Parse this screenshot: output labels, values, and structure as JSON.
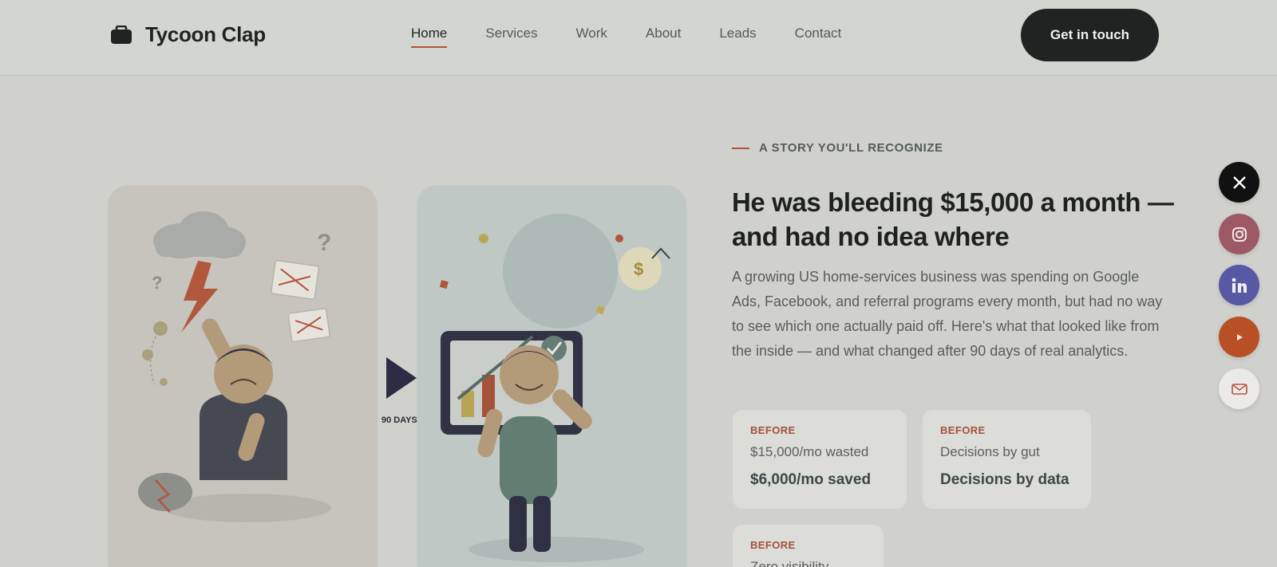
{
  "brand": {
    "name": "Tycoon Clap",
    "icon": "briefcase-icon"
  },
  "nav": {
    "items": [
      {
        "label": "Home",
        "active": true
      },
      {
        "label": "Services",
        "active": false
      },
      {
        "label": "Work",
        "active": false
      },
      {
        "label": "About",
        "active": false
      },
      {
        "label": "Leads",
        "active": false
      },
      {
        "label": "Contact",
        "active": false
      }
    ],
    "cta_label": "Get in touch"
  },
  "illustration": {
    "transition_label": "90 DAYS",
    "before_symbols": [
      "?",
      "?"
    ],
    "after_symbol": "$"
  },
  "story": {
    "eyebrow": "A STORY YOU'LL RECOGNIZE",
    "headline": "He was bleeding $15,000 a month — and had no idea where",
    "body": "A growing US home-services business was spending on Google Ads, Facebook, and referral programs every month, but had no way to see which one actually paid off. Here's what that looked like from the inside — and what changed after 90 days of real analytics.",
    "cards": [
      {
        "tag": "BEFORE",
        "before": "$15,000/mo wasted",
        "after": "$6,000/mo saved"
      },
      {
        "tag": "BEFORE",
        "before": "Decisions by gut",
        "after": "Decisions by data"
      },
      {
        "tag": "BEFORE",
        "before": "Zero visibility",
        "after": ""
      }
    ]
  },
  "social": [
    {
      "name": "x-icon",
      "color": "#111111"
    },
    {
      "name": "instagram-icon",
      "color": "#9c5865"
    },
    {
      "name": "linkedin-icon",
      "color": "#5858a5"
    },
    {
      "name": "youtube-icon",
      "color": "#b84f25"
    },
    {
      "name": "mail-icon",
      "color": "#eceae9"
    }
  ],
  "colors": {
    "accent": "#b45337",
    "dark": "#202322",
    "background": "#d0d1cc"
  }
}
